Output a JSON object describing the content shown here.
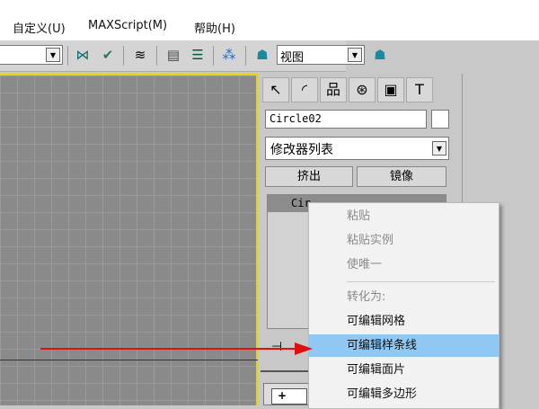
{
  "menubar": {
    "items": [
      "自定义(U)",
      "MAXScript(M)",
      "帮助(H)"
    ]
  },
  "toolbar": {
    "view_combo": "视图"
  },
  "panel": {
    "object_name": "Circle02",
    "modifier_list": "修改器列表",
    "buttons": [
      "挤出",
      "镜像"
    ],
    "stack_item": "Cir"
  },
  "context_menu": {
    "items": [
      {
        "label": "粘贴",
        "enabled": false
      },
      {
        "label": "粘贴实例",
        "enabled": false
      },
      {
        "label": "使唯一",
        "enabled": false
      },
      {
        "label": "转化为:",
        "enabled": false
      },
      {
        "label": "可编辑网格",
        "enabled": true
      },
      {
        "label": "可编辑样条线",
        "enabled": true,
        "highlighted": true
      },
      {
        "label": "可编辑面片",
        "enabled": true
      },
      {
        "label": "可编辑多边形",
        "enabled": true
      }
    ]
  },
  "colors": {
    "highlight": "#90c8f4",
    "viewport_border": "#e8d500",
    "arrow": "#e01010"
  },
  "bottom": {
    "expand": "+"
  }
}
